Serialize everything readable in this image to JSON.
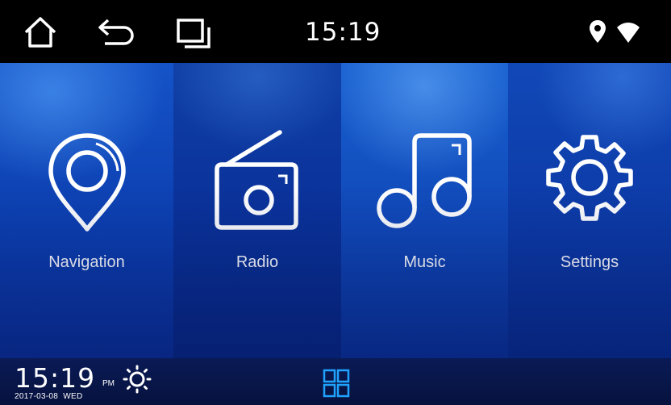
{
  "status_bar": {
    "time": "15:19",
    "icons": [
      "home-icon",
      "back-icon",
      "recent-apps-icon",
      "location-icon",
      "wifi-icon"
    ]
  },
  "tiles": [
    {
      "label": "Navigation",
      "icon": "navigation-pin-icon"
    },
    {
      "label": "Radio",
      "icon": "radio-icon"
    },
    {
      "label": "Music",
      "icon": "music-note-icon"
    },
    {
      "label": "Settings",
      "icon": "gear-icon"
    }
  ],
  "dock": {
    "clock_time": "15:19",
    "ampm": "PM",
    "date": "2017-03-08",
    "weekday": "WED",
    "weather_icon": "sun-icon",
    "apps_icon": "app-grid-icon",
    "accent": "#1fa3ff"
  }
}
